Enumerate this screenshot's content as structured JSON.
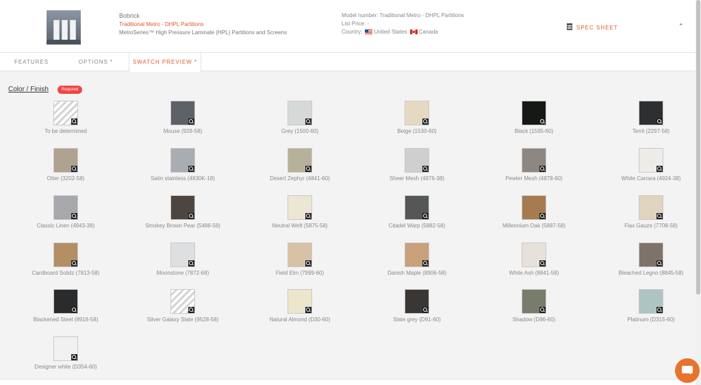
{
  "header": {
    "brand": "Bobrick",
    "product": "Traditional Metro - DHPL Partitions",
    "series": "MetroSeries™ High Pressure Laminate (HPL) Partitions and Screens",
    "model": "Model number: Traditional Metro - DHPL Partitions",
    "list_price": "List Price: -",
    "country_label": "Country:",
    "country_1": "United States",
    "country_2": "Canada",
    "spec_sheet": "SPEC SHEET",
    "collapse_glyph": "⌃"
  },
  "tabs": [
    "FEATURES",
    "OPTIONS *",
    "SWATCH PREVIEW *"
  ],
  "section": {
    "title": "Color / Finish",
    "badge": "Required"
  },
  "swatches": [
    {
      "label": "To be determined",
      "color": "#ffffff",
      "pattern": "striped"
    },
    {
      "label": "Mouse (928-58)",
      "color": "#5d6065"
    },
    {
      "label": "Grey (1500-60)",
      "color": "#d5dad8"
    },
    {
      "label": "Beige (1530-60)",
      "color": "#e6d9c2"
    },
    {
      "label": "Black (1595-60)",
      "color": "#161816"
    },
    {
      "label": "Terril (2297-58)",
      "color": "#2e2f31"
    },
    {
      "label": "Otter (3202-58)",
      "color": "#b1a190"
    },
    {
      "label": "Satin stainless (4830K-18)",
      "color": "#a9acb0"
    },
    {
      "label": "Desert Zephyr (4841-60)",
      "color": "#b7b199"
    },
    {
      "label": "Sheer Mesh (4876-38)",
      "color": "#cdd0cf"
    },
    {
      "label": "Pewter Mesh (4878-60)",
      "color": "#8d8783"
    },
    {
      "label": "White Carrara (4924-38)",
      "color": "#eeece9"
    },
    {
      "label": "Classic Linen (4943-38)",
      "color": "#a6a8ab"
    },
    {
      "label": "Smokey Brown Pear (5488-58)",
      "color": "#4f4540"
    },
    {
      "label": "Neutral Weft (5875-58)",
      "color": "#ede6d5"
    },
    {
      "label": "Citadel Warp (5882-58)",
      "color": "#545658"
    },
    {
      "label": "Millennium Oak (5887-58)",
      "color": "#a57b4f"
    },
    {
      "label": "Flax Gauze (7708-58)",
      "color": "#e0d4bf"
    },
    {
      "label": "Cardboard Solidz (7813-58)",
      "color": "#b48e64"
    },
    {
      "label": "Moonstone (7872-68)",
      "color": "#dedfe1"
    },
    {
      "label": "Field Elm (7999-60)",
      "color": "#d8c2a5"
    },
    {
      "label": "Danish Maple (8906-58)",
      "color": "#c8a07a"
    },
    {
      "label": "White Ash (8841-58)",
      "color": "#e6e2db"
    },
    {
      "label": "Bleached Legno (8845-58)",
      "color": "#7e736b"
    },
    {
      "label": "Blackened Steel (8918-58)",
      "color": "#2a2b2d"
    },
    {
      "label": "Silver Galaxy Slate (9528-58)",
      "color": "#ffffff",
      "pattern": "striped"
    },
    {
      "label": "Natural Almond (D30-60)",
      "color": "#ece6cc"
    },
    {
      "label": "Slate grey (D91-60)",
      "color": "#3a3634"
    },
    {
      "label": "Shadow (D96-60)",
      "color": "#777d6a"
    },
    {
      "label": "Platinum (D315-60)",
      "color": "#aec4c2"
    },
    {
      "label": "Designer white (D354-60)",
      "color": "#f2f1f1"
    }
  ],
  "colors": {
    "accent": "#e4572e",
    "badge": "#f14545",
    "chat": "#e8732b"
  }
}
